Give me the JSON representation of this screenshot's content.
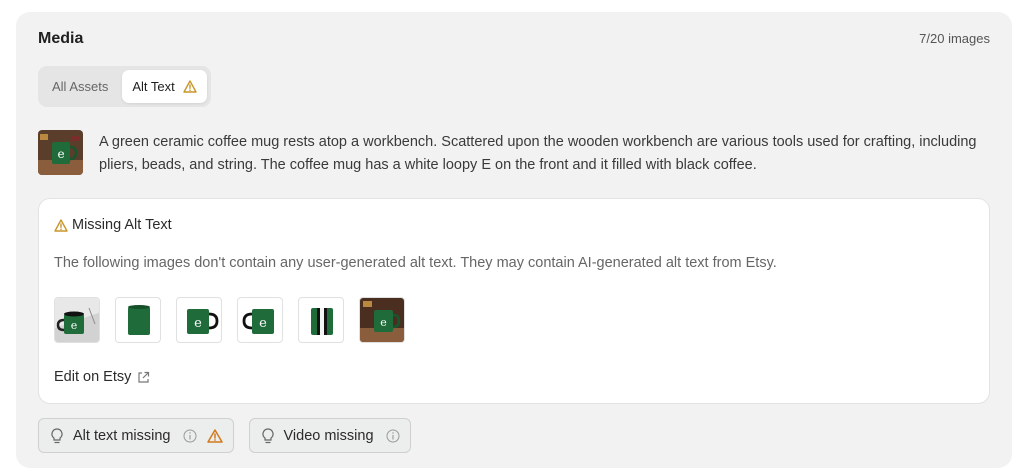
{
  "media": {
    "title": "Media",
    "count_label": "7/20 images"
  },
  "tabs": [
    {
      "label": "All Assets",
      "active": false
    },
    {
      "label": "Alt Text",
      "active": true,
      "icon": "warning-triangle-icon"
    }
  ],
  "description": "A green ceramic coffee mug rests atop a workbench. Scattered upon the wooden workbench are various tools used for crafting, including pliers, beads, and string. The coffee mug has a white loopy E on the front and it filled with black coffee.",
  "missing_panel": {
    "heading": "Missing Alt Text",
    "message": "The following images don't contain any user-generated alt text. They may contain AI-generated alt text from Etsy.",
    "thumbnails": [
      "mug-angled-photo",
      "mug-side-view",
      "mug-front-handle-right",
      "mug-front-handle-left",
      "mug-back-view",
      "mug-on-workbench"
    ],
    "edit_link": "Edit on Etsy"
  },
  "badges": [
    {
      "label": "Alt text missing",
      "has_warning": true
    },
    {
      "label": "Video missing",
      "has_warning": false
    }
  ],
  "colors": {
    "warning": "#c9962a",
    "mug_green": "#1f6b3a",
    "card_bg": "#f1f2f1"
  }
}
